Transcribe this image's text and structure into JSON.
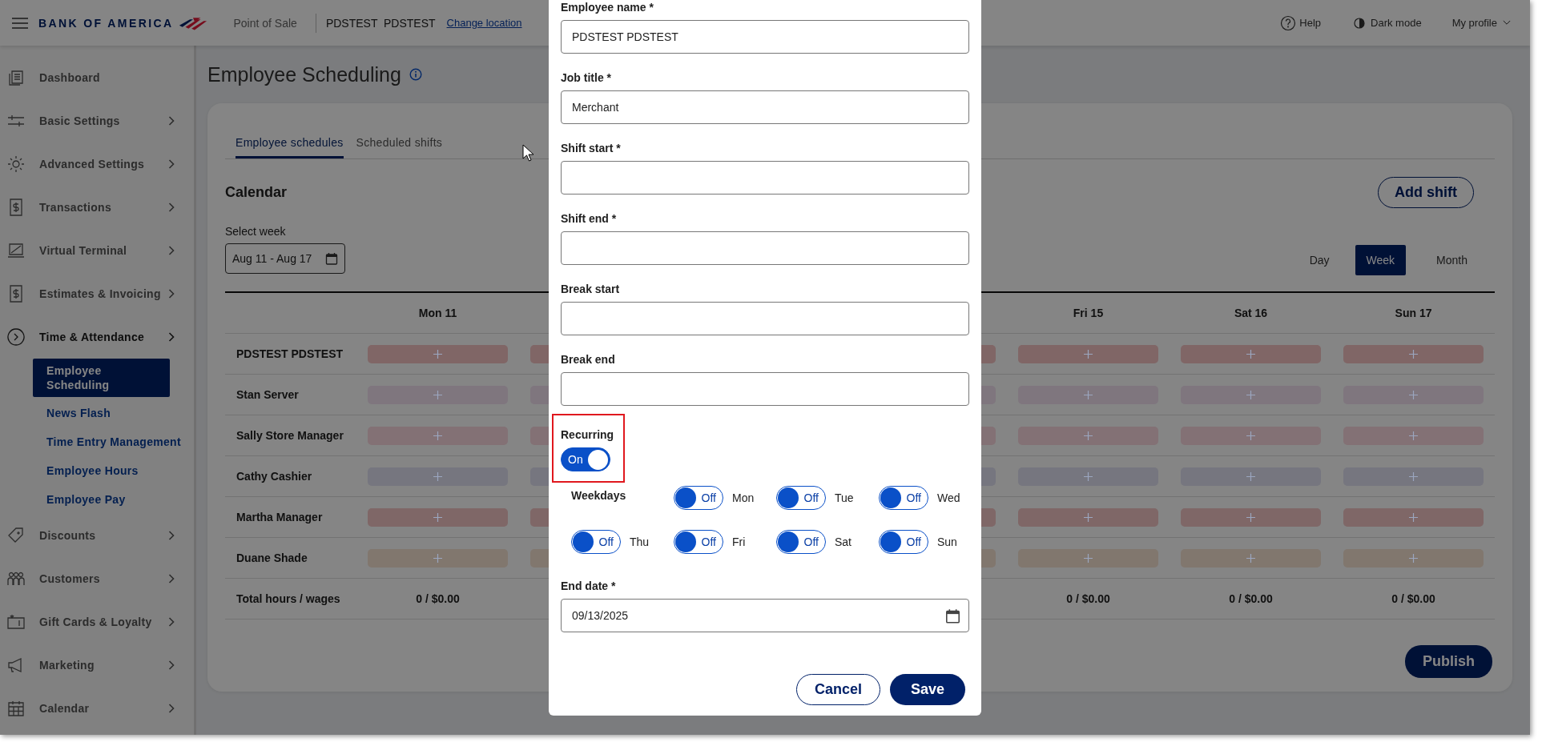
{
  "header": {
    "brand": "BANK OF AMERICA",
    "app_name": "Point of Sale",
    "location": "PDSTEST  PDSTEST",
    "change_location": "Change location",
    "help": "Help",
    "dark_mode": "Dark mode",
    "profile": "My profile"
  },
  "sidebar": {
    "items": [
      {
        "label": "Dashboard",
        "expandable": false,
        "selected": false
      },
      {
        "label": "Basic Settings",
        "expandable": true,
        "selected": false
      },
      {
        "label": "Advanced Settings",
        "expandable": true,
        "selected": false
      },
      {
        "label": "Transactions",
        "expandable": true,
        "selected": false
      },
      {
        "label": "Virtual Terminal",
        "expandable": true,
        "selected": false
      },
      {
        "label": "Estimates & Invoicing",
        "expandable": true,
        "selected": false
      },
      {
        "label": "Time & Attendance",
        "expandable": true,
        "selected": true,
        "children": [
          {
            "label": "Employee Scheduling",
            "selected": true
          },
          {
            "label": "News Flash",
            "selected": false
          },
          {
            "label": "Time Entry Management",
            "selected": false
          },
          {
            "label": "Employee Hours",
            "selected": false
          },
          {
            "label": "Employee Pay",
            "selected": false
          }
        ]
      },
      {
        "label": "Discounts",
        "expandable": true,
        "selected": false
      },
      {
        "label": "Customers",
        "expandable": true,
        "selected": false
      },
      {
        "label": "Gift Cards & Loyalty",
        "expandable": true,
        "selected": false
      },
      {
        "label": "Marketing",
        "expandable": true,
        "selected": false
      },
      {
        "label": "Calendar",
        "expandable": true,
        "selected": false
      }
    ]
  },
  "page": {
    "title": "Employee Scheduling"
  },
  "tabs": [
    {
      "label": "Employee schedules",
      "selected": true
    },
    {
      "label": "Scheduled shifts",
      "selected": false
    }
  ],
  "calendar": {
    "title": "Calendar",
    "add_shift": "Add shift",
    "week_label": "Select week",
    "week_value": "Aug 11 - Aug 17",
    "views": [
      {
        "label": "Day",
        "selected": false
      },
      {
        "label": "Week",
        "selected": true
      },
      {
        "label": "Month",
        "selected": false
      }
    ],
    "columns": [
      "Mon 11",
      "Fri 15",
      "Sat 16",
      "Sun 17"
    ],
    "rows": [
      {
        "name": "PDSTEST PDSTEST",
        "color": "#806666"
      },
      {
        "name": "Stan Server",
        "color": "#7f767e"
      },
      {
        "name": "Sally Store Manager",
        "color": "#837175"
      },
      {
        "name": "Cathy Cashier",
        "color": "#76767f"
      },
      {
        "name": "Martha Manager",
        "color": "#7f6767"
      },
      {
        "name": "Duane Shade",
        "color": "#81776e"
      }
    ],
    "total_label": "Total hours / wages",
    "totals": [
      "0 / $0.00",
      "0 / $0.00",
      "0 / $0.00",
      "0 / $0.00"
    ],
    "publish": "Publish"
  },
  "dialog": {
    "fields": [
      {
        "label": "Employee name *",
        "value": "PDSTEST PDSTEST"
      },
      {
        "label": "Job title *",
        "value": "Merchant"
      },
      {
        "label": "Shift start *"
      },
      {
        "label": "Shift end *"
      },
      {
        "label": "Break start"
      },
      {
        "label": "Break end"
      }
    ],
    "recurring": {
      "label": "Recurring",
      "on": true,
      "state_text": "On"
    },
    "weekdays": {
      "label": "Weekdays",
      "days": [
        {
          "label": "Mon",
          "on": false,
          "state_text": "Off"
        },
        {
          "label": "Tue",
          "on": false,
          "state_text": "Off"
        },
        {
          "label": "Wed",
          "on": false,
          "state_text": "Off"
        },
        {
          "label": "Thu",
          "on": false,
          "state_text": "Off"
        },
        {
          "label": "Fri",
          "on": false,
          "state_text": "Off"
        },
        {
          "label": "Sat",
          "on": false,
          "state_text": "Off"
        },
        {
          "label": "Sun",
          "on": false,
          "state_text": "Off"
        }
      ]
    },
    "end_date": {
      "label": "End date *",
      "value": "09/13/2025"
    },
    "cancel": "Cancel",
    "save": "Save"
  }
}
